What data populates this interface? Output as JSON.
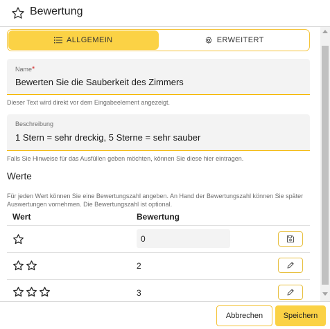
{
  "header": {
    "title": "Bewertung",
    "icon": "star-outline-icon"
  },
  "tabs": [
    {
      "label": "ALLGEMEIN",
      "icon": "list-icon",
      "active": true
    },
    {
      "label": "ERWEITERT",
      "icon": "gear-icon",
      "active": false
    }
  ],
  "name_field": {
    "label": "Name",
    "required_mark": "*",
    "value": "Bewerten Sie die Sauberkeit des Zimmers",
    "hint": "Dieser Text wird direkt vor dem Eingabeelement angezeigt."
  },
  "description_field": {
    "label": "Beschreibung",
    "value": "1 Stern = sehr dreckig, 5 Sterne = sehr sauber",
    "hint": "Falls Sie Hinweise für das Ausfüllen geben möchten, können Sie diese hier eintragen."
  },
  "values_section": {
    "title": "Werte",
    "description": "Für jeden Wert können Sie eine Bewertungszahl angeben. An Hand der Bewertungszahl können Sie später Auswertungen vornehmen. Die Bewertungszahl ist optional.",
    "columns": [
      "Wert",
      "Bewertung"
    ],
    "rows": [
      {
        "stars": 1,
        "rating": "0",
        "editing": true,
        "action_icon": "save-icon"
      },
      {
        "stars": 2,
        "rating": "2",
        "editing": false,
        "action_icon": "pencil-icon"
      },
      {
        "stars": 3,
        "rating": "3",
        "editing": false,
        "action_icon": "pencil-icon"
      }
    ]
  },
  "footer": {
    "cancel_label": "Abbrechen",
    "save_label": "Speichern"
  },
  "colors": {
    "accent": "#fbd245",
    "accent_border": "#f5c43a",
    "required": "#d32f2f",
    "field_bg": "#f3f3f3"
  }
}
